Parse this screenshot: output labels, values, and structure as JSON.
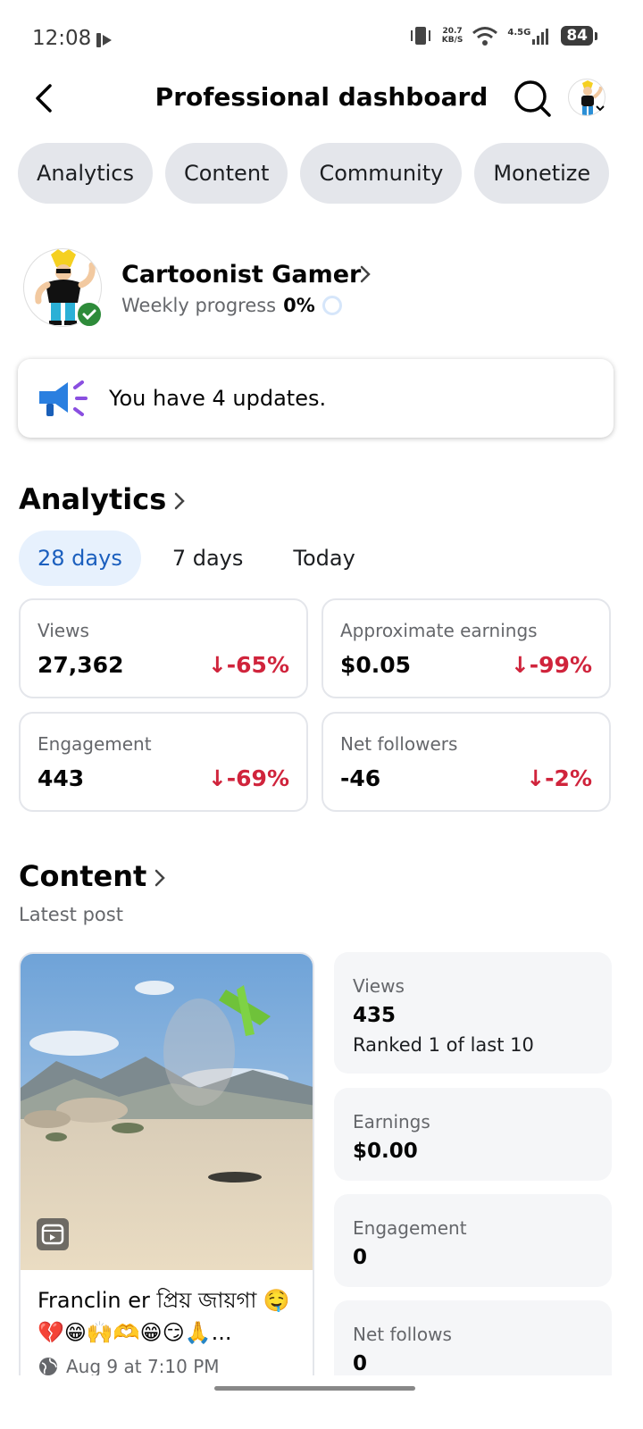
{
  "status_bar": {
    "time": "12:08",
    "net_speed_value": "20.7",
    "net_speed_unit": "KB/S",
    "signal_label": "4.5G",
    "battery": "84"
  },
  "header": {
    "title": "Professional dashboard"
  },
  "chips": [
    "Analytics",
    "Content",
    "Community",
    "Monetize"
  ],
  "profile": {
    "name": "Cartoonist Gamer",
    "weekly_label": "Weekly progress",
    "weekly_value": "0%"
  },
  "updates": {
    "text": "You have 4 updates."
  },
  "analytics": {
    "title": "Analytics",
    "tabs": [
      "28 days",
      "7 days",
      "Today"
    ],
    "active_tab": "28 days",
    "cards": [
      {
        "label": "Views",
        "value": "27,362",
        "delta": "-65%"
      },
      {
        "label": "Approximate earnings",
        "value": "$0.05",
        "delta": "-99%"
      },
      {
        "label": "Engagement",
        "value": "443",
        "delta": "-69%"
      },
      {
        "label": "Net followers",
        "value": "-46",
        "delta": "-2%"
      }
    ]
  },
  "content": {
    "title": "Content",
    "latest_label": "Latest post",
    "post": {
      "caption": "Franclin er প্রিয় জায়গা 🤤💔😁🙌🫶😁😏🙏...",
      "date": "Aug 9 at 7:10 PM"
    },
    "metrics": [
      {
        "label": "Views",
        "value": "435",
        "note": "Ranked 1 of last 10"
      },
      {
        "label": "Earnings",
        "value": "$0.00"
      },
      {
        "label": "Engagement",
        "value": "0"
      },
      {
        "label": "Net follows",
        "value": "0"
      }
    ]
  },
  "colors": {
    "accent_blue": "#1b5fbe",
    "negative_red": "#d0243c",
    "chip_bg": "#e4e6eb",
    "verified_green": "#2e8b3a"
  }
}
